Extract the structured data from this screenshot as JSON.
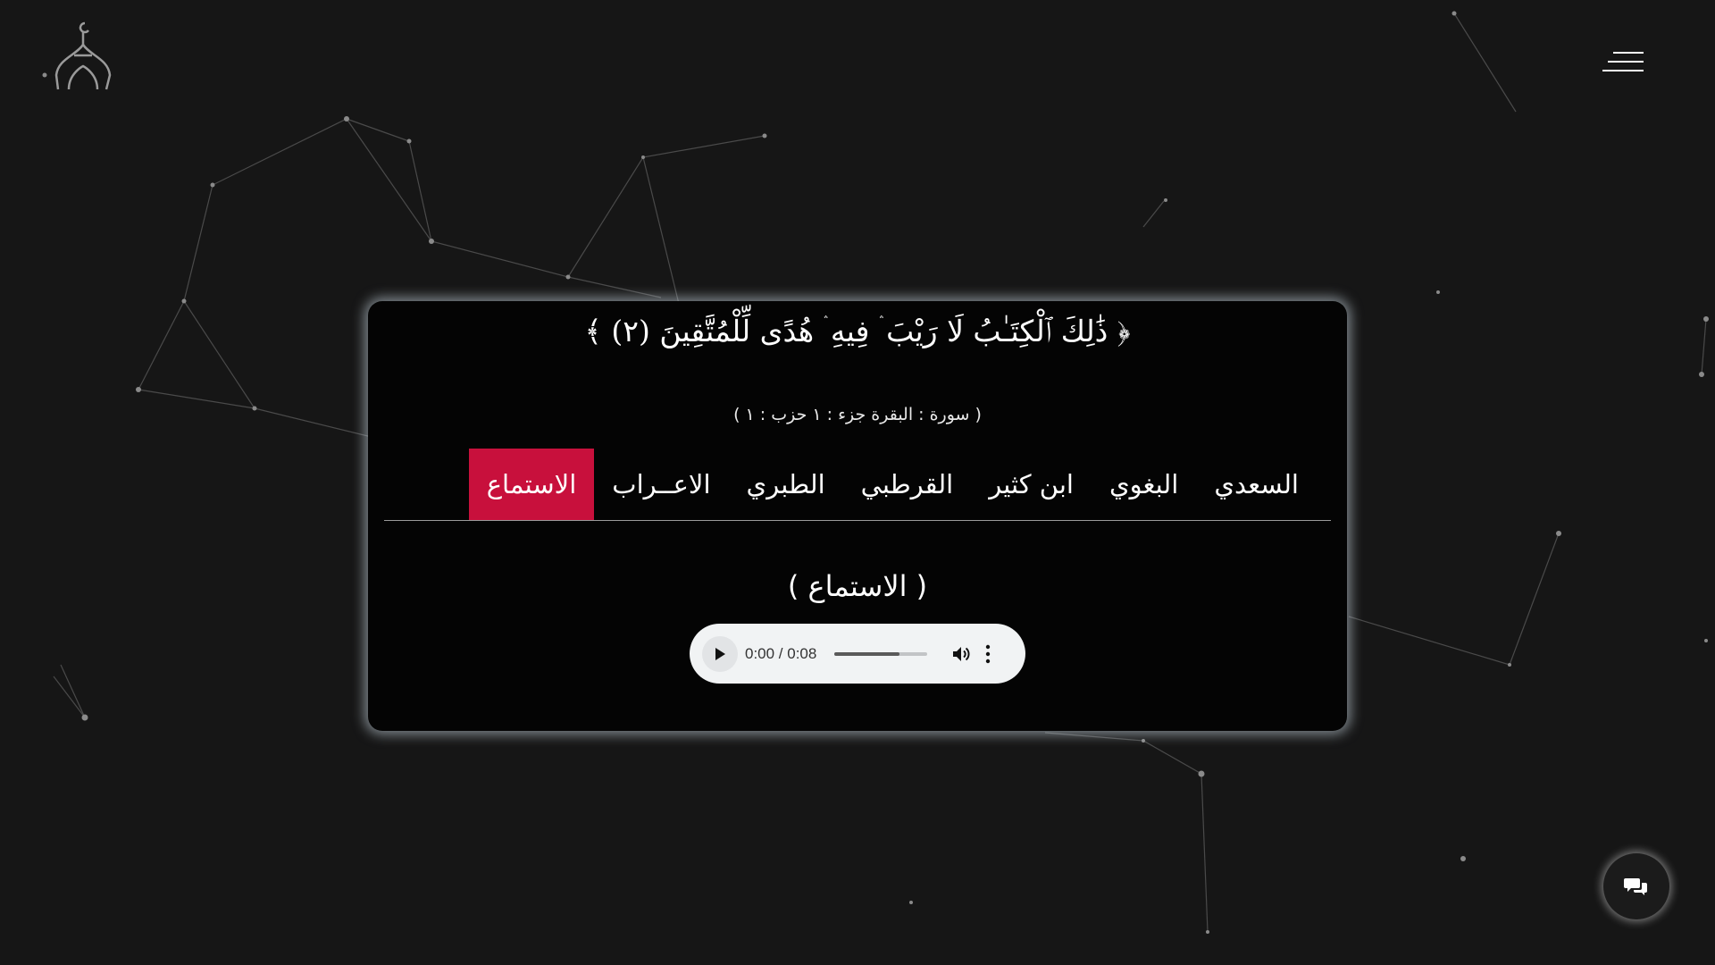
{
  "verse": {
    "text": "﴿ ذَٰلِكَ ٱلْكِتَـٰبُ لَا رَيْبَ ۛ فِيهِ ۛ هُدًى لِّلْمُتَّقِينَ (٢) ﴾"
  },
  "meta": {
    "text": "( سورة : البقرة جزء : ١ حزب : ١ )"
  },
  "tabs": [
    {
      "label": "السعدي",
      "active": false
    },
    {
      "label": "البغوي",
      "active": false
    },
    {
      "label": "ابن كثير",
      "active": false
    },
    {
      "label": "القرطبي",
      "active": false
    },
    {
      "label": "الطبري",
      "active": false
    },
    {
      "label": "الاعــراب",
      "active": false
    },
    {
      "label": "الاستماع",
      "active": true
    }
  ],
  "section": {
    "title": "( الاستماع )"
  },
  "audio": {
    "time": "0:00 / 0:08",
    "volume_level": 0.7
  },
  "icons": {
    "logo": "mosque-dome-icon",
    "menu": "hamburger-menu-icon",
    "chat": "chat-bubbles-icon",
    "play": "play-icon",
    "volume": "volume-icon",
    "more": "more-vertical-icon"
  },
  "colors": {
    "background": "#161616",
    "card": "#040404",
    "active_tab": "#c8103c",
    "player": "#f1f3f4"
  }
}
